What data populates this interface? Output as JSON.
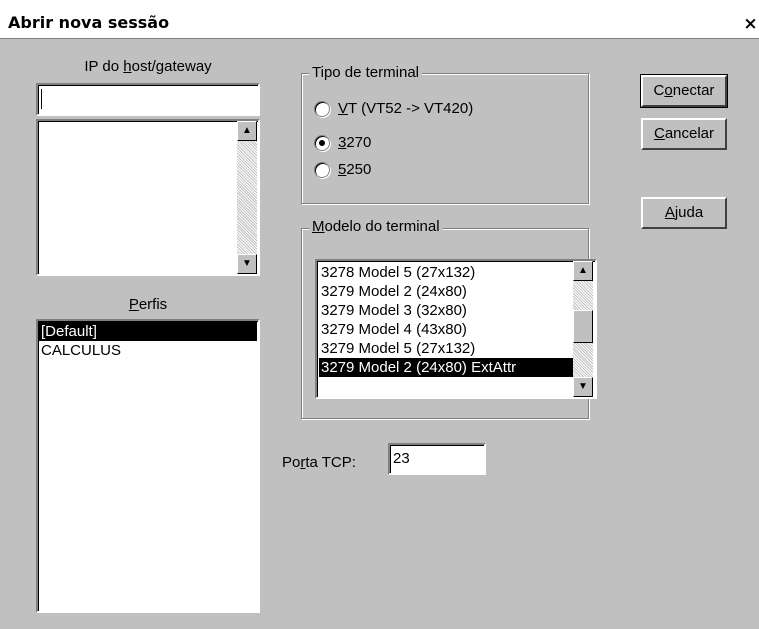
{
  "window": {
    "title": "Abrir nova sessão",
    "close_label": "×"
  },
  "host": {
    "label": "IP do host/gateway",
    "value": ""
  },
  "profiles": {
    "label": "Perfis",
    "items": [
      "[Default]",
      "CALCULUS"
    ],
    "selected_index": 0
  },
  "terminal_type": {
    "label": "Tipo de terminal",
    "options": [
      "VT (VT52 -> VT420)",
      "3270",
      "5250"
    ],
    "selected_index": 1
  },
  "terminal_model": {
    "label": "Modelo do terminal",
    "items": [
      "3278 Model 5 (27x132)",
      "3279 Model 2 (24x80)",
      "3279 Model 3 (32x80)",
      "3279 Model 4 (43x80)",
      "3279 Model 5 (27x132)",
      "3279 Model 2 (24x80) ExtAttr"
    ],
    "selected_index": 5
  },
  "port": {
    "label": "Porta TCP:",
    "value": "23"
  },
  "buttons": {
    "connect": "Conectar",
    "cancel": "Cancelar",
    "help": "Ajuda"
  },
  "icons": {
    "scroll_up": "arrow-up-icon",
    "scroll_down": "arrow-down-icon"
  }
}
